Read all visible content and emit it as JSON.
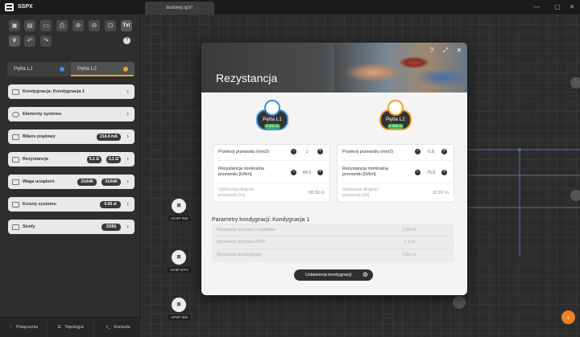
{
  "app": {
    "title": "SSPX",
    "tab": "testowy.spx*"
  },
  "window_controls": {
    "minimize": "—",
    "maximize": "▢",
    "close": "✕"
  },
  "toolbar": {
    "txt": "Txt",
    "help": "?"
  },
  "loops": [
    {
      "label": "Pętla L1",
      "color": "#3a8ee0"
    },
    {
      "label": "Pętla L2",
      "color": "#f0a030"
    }
  ],
  "menu": [
    {
      "label": "Kondygnacja: Kondygnacja 1"
    },
    {
      "label": "Elementy systemu"
    },
    {
      "label": "Bilans prądowy",
      "value": "214.4 mA"
    },
    {
      "label": "Rezystancja",
      "v1": "5.1 Ω",
      "v2": "2.1 Ω",
      "b1": "L1",
      "b2": "L2"
    },
    {
      "label": "Waga urządzeń",
      "v1": "21/640",
      "v2": "31/640",
      "b1": "L1",
      "b2": "L2"
    },
    {
      "label": "Koszty systemu",
      "value": "0.00 zł"
    },
    {
      "label": "Strefy",
      "value": "2/256"
    }
  ],
  "bottom": {
    "connections": "Połączenia",
    "topology": "Topologia",
    "console": "Konsola"
  },
  "devices": [
    {
      "label": "ACSP-RSI"
    },
    {
      "label": "ACSP-ETH"
    },
    {
      "label": "APSP-402"
    }
  ],
  "modal": {
    "title": "Rezystancja",
    "loop1": {
      "name": "Pętla L1",
      "value": "5.101 Ω",
      "color": "#3a8ee0"
    },
    "loop2": {
      "name": "Pętla L2",
      "value": "2.065 Ω",
      "color": "#f0a030"
    },
    "left": {
      "cross_section_label": "Przekrój przewodu (mm2)",
      "cross_section": "1",
      "resistance_label": "Rezystancja nominalna przewodu [Ω/km]",
      "resistance": "48.0",
      "length_label": "Obliczona długość przewodu [m]",
      "length": "88.56 m"
    },
    "right": {
      "cross_section_label": "Przekrój przewodu (mm2)",
      "cross_section": "0.8",
      "resistance_label": "Rezystancja nominalna przewodu [Ω/km]",
      "resistance": "75.0",
      "length_label": "Obliczona długość przewodu [m]",
      "length": "22.87 m"
    },
    "params_title": "Parametry kondygnacji: Kondygnacja 1",
    "params": [
      {
        "label": "Wysokość montażu czujników",
        "value": "2.55 m"
      },
      {
        "label": "Wysokość montażu ROP",
        "value": "1.1 m"
      },
      {
        "label": "Wysokość kondygnacji",
        "value": "2.55 m"
      }
    ],
    "settings_button": "Ustawienia kondygnacji"
  }
}
